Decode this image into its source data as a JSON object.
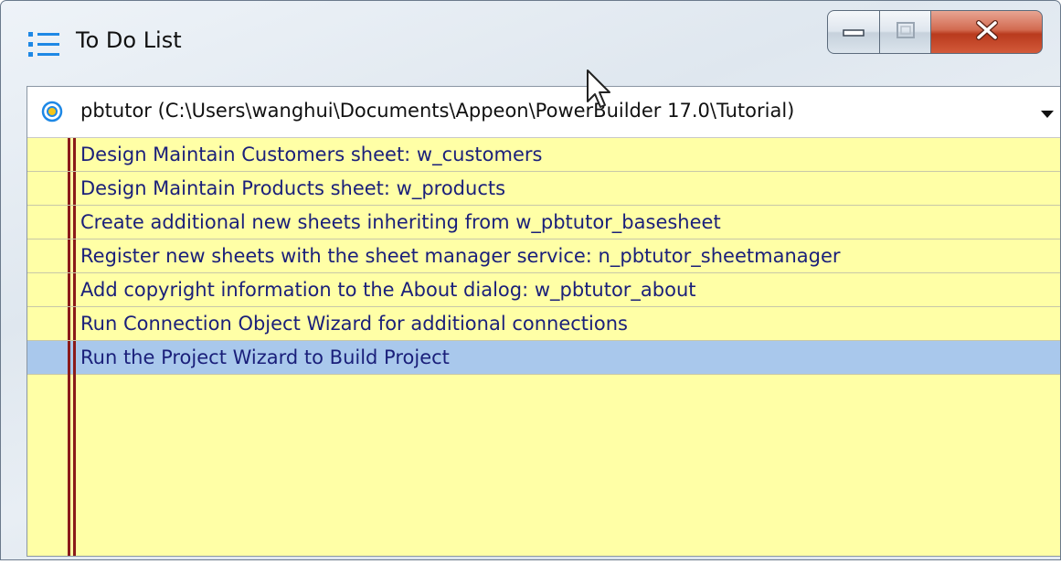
{
  "window": {
    "title": "To Do List",
    "icon": "list-icon",
    "controls": {
      "minimize_icon": "minimize-icon",
      "maximize_icon": "maximize-icon",
      "close_icon": "close-icon"
    }
  },
  "project": {
    "icon": "target-icon",
    "label": "pbtutor (C:\\Users\\wanghui\\Documents\\Appeon\\PowerBuilder 17.0\\Tutorial)",
    "dropdown_icon": "chevron-down-icon"
  },
  "todo_items": [
    {
      "text": "Design Maintain Customers sheet: w_customers",
      "selected": false
    },
    {
      "text": "Design Maintain Products sheet: w_products",
      "selected": false
    },
    {
      "text": "Create additional new sheets inheriting from w_pbtutor_basesheet",
      "selected": false
    },
    {
      "text": "Register new sheets with the sheet manager service: n_pbtutor_sheetmanager",
      "selected": false
    },
    {
      "text": "Add copyright information to the About dialog: w_pbtutor_about",
      "selected": false
    },
    {
      "text": "Run Connection Object Wizard for additional connections",
      "selected": false
    },
    {
      "text": "Run the Project Wizard to Build Project",
      "selected": true
    }
  ],
  "colors": {
    "list_background": "#ffffa6",
    "selected_row": "#a9c8ec",
    "item_text": "#1a1f7a",
    "margin_line": "#8b1a1a",
    "close_button": "#c8462a"
  }
}
